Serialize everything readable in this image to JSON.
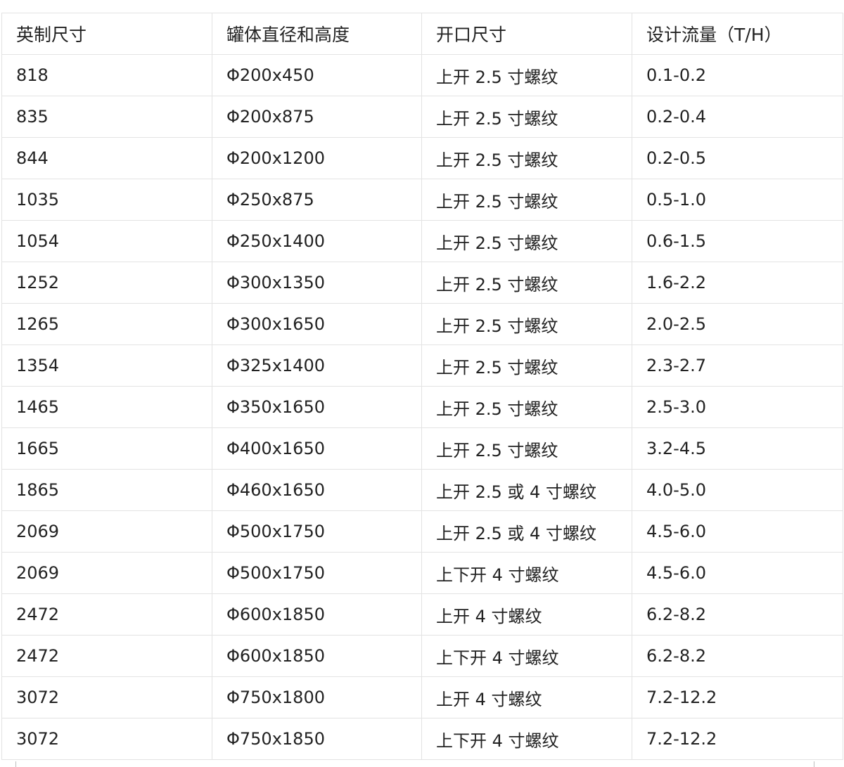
{
  "table": {
    "headers": [
      "英制尺寸",
      "罐体直径和高度",
      "开口尺寸",
      "设计流量（T/H）"
    ],
    "rows": [
      [
        "818",
        "Φ200x450",
        "上开 2.5 寸螺纹",
        "0.1-0.2"
      ],
      [
        "835",
        "Φ200x875",
        "上开 2.5 寸螺纹",
        "0.2-0.4"
      ],
      [
        "844",
        "Φ200x1200",
        "上开 2.5 寸螺纹",
        "0.2-0.5"
      ],
      [
        "1035",
        "Φ250x875",
        "上开 2.5 寸螺纹",
        "0.5-1.0"
      ],
      [
        "1054",
        "Φ250x1400",
        "上开 2.5 寸螺纹",
        "0.6-1.5"
      ],
      [
        "1252",
        "Φ300x1350",
        "上开 2.5 寸螺纹",
        "1.6-2.2"
      ],
      [
        "1265",
        "Φ300x1650",
        "上开 2.5 寸螺纹",
        "2.0-2.5"
      ],
      [
        "1354",
        "Φ325x1400",
        "上开 2.5 寸螺纹",
        "2.3-2.7"
      ],
      [
        "1465",
        "Φ350x1650",
        "上开 2.5 寸螺纹",
        "2.5-3.0"
      ],
      [
        "1665",
        "Φ400x1650",
        "上开 2.5 寸螺纹",
        "3.2-4.5"
      ],
      [
        "1865",
        "Φ460x1650",
        "上开 2.5 或 4 寸螺纹",
        "4.0-5.0"
      ],
      [
        "2069",
        "Φ500x1750",
        "上开 2.5 或 4 寸螺纹",
        "4.5-6.0"
      ],
      [
        "2069",
        "Φ500x1750",
        "上下开 4 寸螺纹",
        "4.5-6.0"
      ],
      [
        "2472",
        "Φ600x1850",
        "上开 4 寸螺纹",
        "6.2-8.2"
      ],
      [
        "2472",
        "Φ600x1850",
        "上下开 4 寸螺纹",
        "6.2-8.2"
      ],
      [
        "3072",
        "Φ750x1800",
        "上开 4 寸螺纹",
        "7.2-12.2"
      ],
      [
        "3072",
        "Φ750x1850",
        "上下开 4 寸螺纹",
        "7.2-12.2"
      ]
    ]
  }
}
